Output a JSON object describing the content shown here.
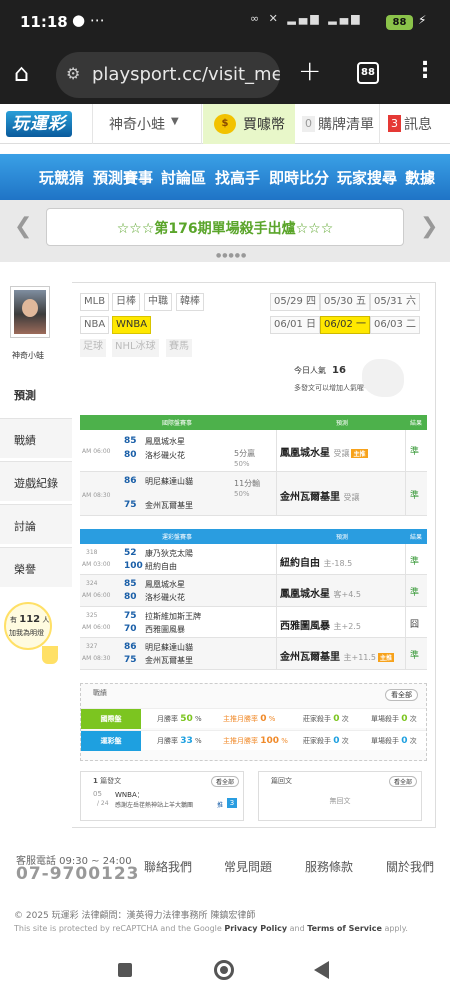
{
  "status": {
    "time": "11:18",
    "battery": "88"
  },
  "browser": {
    "url": "playsport.cc/visit_mer",
    "tab_count": "88"
  },
  "header": {
    "logo": "玩運彩",
    "username": "神奇小蛙",
    "coin_label": "買噱幣",
    "coin_icon_text": "$",
    "purchase_count": "0",
    "purchase_label": "購牌清單",
    "message_count": "3",
    "message_label": "訊息"
  },
  "nav": [
    "玩競猜",
    "預測賽事",
    "討論區",
    "找高手",
    "即時比分",
    "玩家搜尋",
    "數據"
  ],
  "banner": {
    "text": "☆☆☆第176期單場殺手出爐☆☆☆",
    "dots": "●●●●●"
  },
  "sidebar": {
    "avatar_name": "神奇小蛙",
    "items": [
      "預測",
      "戰績",
      "遊戲紀錄",
      "討論",
      "榮譽"
    ],
    "bulb_pre": "有",
    "bulb_count": "112",
    "bulb_suffix": "人",
    "bulb_line2": "加我為明燈"
  },
  "leagues": [
    [
      "MLB",
      "日棒",
      "中職",
      "韓棒"
    ],
    [
      "NBA",
      "WNBA"
    ],
    [
      "足球",
      "NHL冰球",
      "賽馬"
    ]
  ],
  "dates": [
    [
      "05/29 四",
      "05/30 五",
      "05/31 六"
    ],
    [
      "06/01 日",
      "06/02 一",
      "06/03 二"
    ]
  ],
  "visitors": {
    "label": "今日人氣",
    "count": "16",
    "note": "多發文可以增加人氣喔~"
  },
  "intl": {
    "headers": {
      "title": "國際盤賽事",
      "pred": "預測",
      "res": "結果"
    },
    "rows": [
      {
        "time": "AM 06:00",
        "n1": "85",
        "t1": "鳳凰城水星",
        "n2": "80",
        "t2": "洛杉磯火花",
        "line": "5分贏",
        "pct": "50%",
        "pred": "鳳凰城水星",
        "ptype": "受讓",
        "result": "準"
      },
      {
        "time": "AM 08:30",
        "n1": "86",
        "t1": "明尼蘇達山貓",
        "n2": "75",
        "t2": "金州瓦爾基里",
        "line": "11分輸",
        "pct": "50%",
        "pred": "金州瓦爾基里",
        "ptype": "受讓",
        "result": "準"
      }
    ]
  },
  "tw": {
    "headers": {
      "title": "運彩盤賽事",
      "pred": "預測",
      "res": "結果"
    },
    "rows": [
      {
        "id": "318",
        "time": "AM 03:00",
        "n1": "52",
        "t1": "康乃狄克太陽",
        "n2": "100",
        "t2": "紐約自由",
        "pred": "紐約自由",
        "ptype": "主",
        "odds": "-18.5",
        "result": "準"
      },
      {
        "id": "324",
        "time": "AM 06:00",
        "n1": "85",
        "t1": "鳳凰城水星",
        "n2": "80",
        "t2": "洛杉磯火花",
        "pred": "鳳凰城水星",
        "ptype": "客",
        "odds": "+4.5",
        "result": "準"
      },
      {
        "id": "325",
        "time": "AM 06:00",
        "n1": "75",
        "t1": "拉斯維加斯王牌",
        "n2": "70",
        "t2": "西雅圖風暴",
        "pred": "西雅圖風暴",
        "ptype": "主",
        "odds": "+2.5",
        "result": "囧"
      },
      {
        "id": "327",
        "time": "AM 08:30",
        "n1": "86",
        "t1": "明尼蘇達山貓",
        "n2": "75",
        "t2": "金州瓦爾基里",
        "pred": "金州瓦爾基里",
        "ptype": "主",
        "odds": "+11.5",
        "result": "準"
      }
    ]
  },
  "records": {
    "title": "戰績",
    "all": "看全部",
    "rows": [
      {
        "label": "國際盤",
        "month_label": "月勝率",
        "month": "50",
        "killer_label": "主推月勝率",
        "killer": "0",
        "home_label": "莊家殺手",
        "home": "0",
        "single_label": "單場殺手",
        "single": "0",
        "color": "#7cc520"
      },
      {
        "label": "運彩盤",
        "month_label": "月勝率",
        "month": "33",
        "killer_label": "主推月勝率",
        "killer": "100",
        "home_label": "莊家殺手",
        "home": "0",
        "single_label": "單場殺手",
        "single": "0",
        "color": "#1ea0e0"
      }
    ],
    "unit_pct": "%",
    "unit_count": "次"
  },
  "posts": {
    "count": "1",
    "label": "篇發文",
    "all": "看全部",
    "date": "05",
    "date2": "/ 24",
    "tag": "WNBA：",
    "text": "感謝左岳荏熱神站上羊大鵝團",
    "push_label": "推",
    "push": "3"
  },
  "replies": {
    "label": "篇回文",
    "all": "看全部",
    "empty": "無回文"
  },
  "footer": {
    "tel_label": "客服電話 09:30 ~ 24:00",
    "tel": "07-9700123",
    "links": [
      "聯絡我們",
      "常見問題",
      "服務條款",
      "關於我們"
    ],
    "copyright": "© 2025 玩運彩 法律顧問：漢英得力法律事務所 陳鎮宏律師",
    "recaptcha_pre": "This site is protected by reCAPTCHA and the Google ",
    "privacy": "Privacy Policy",
    "and": " and ",
    "terms": "Terms of Service",
    "apply": " apply."
  }
}
